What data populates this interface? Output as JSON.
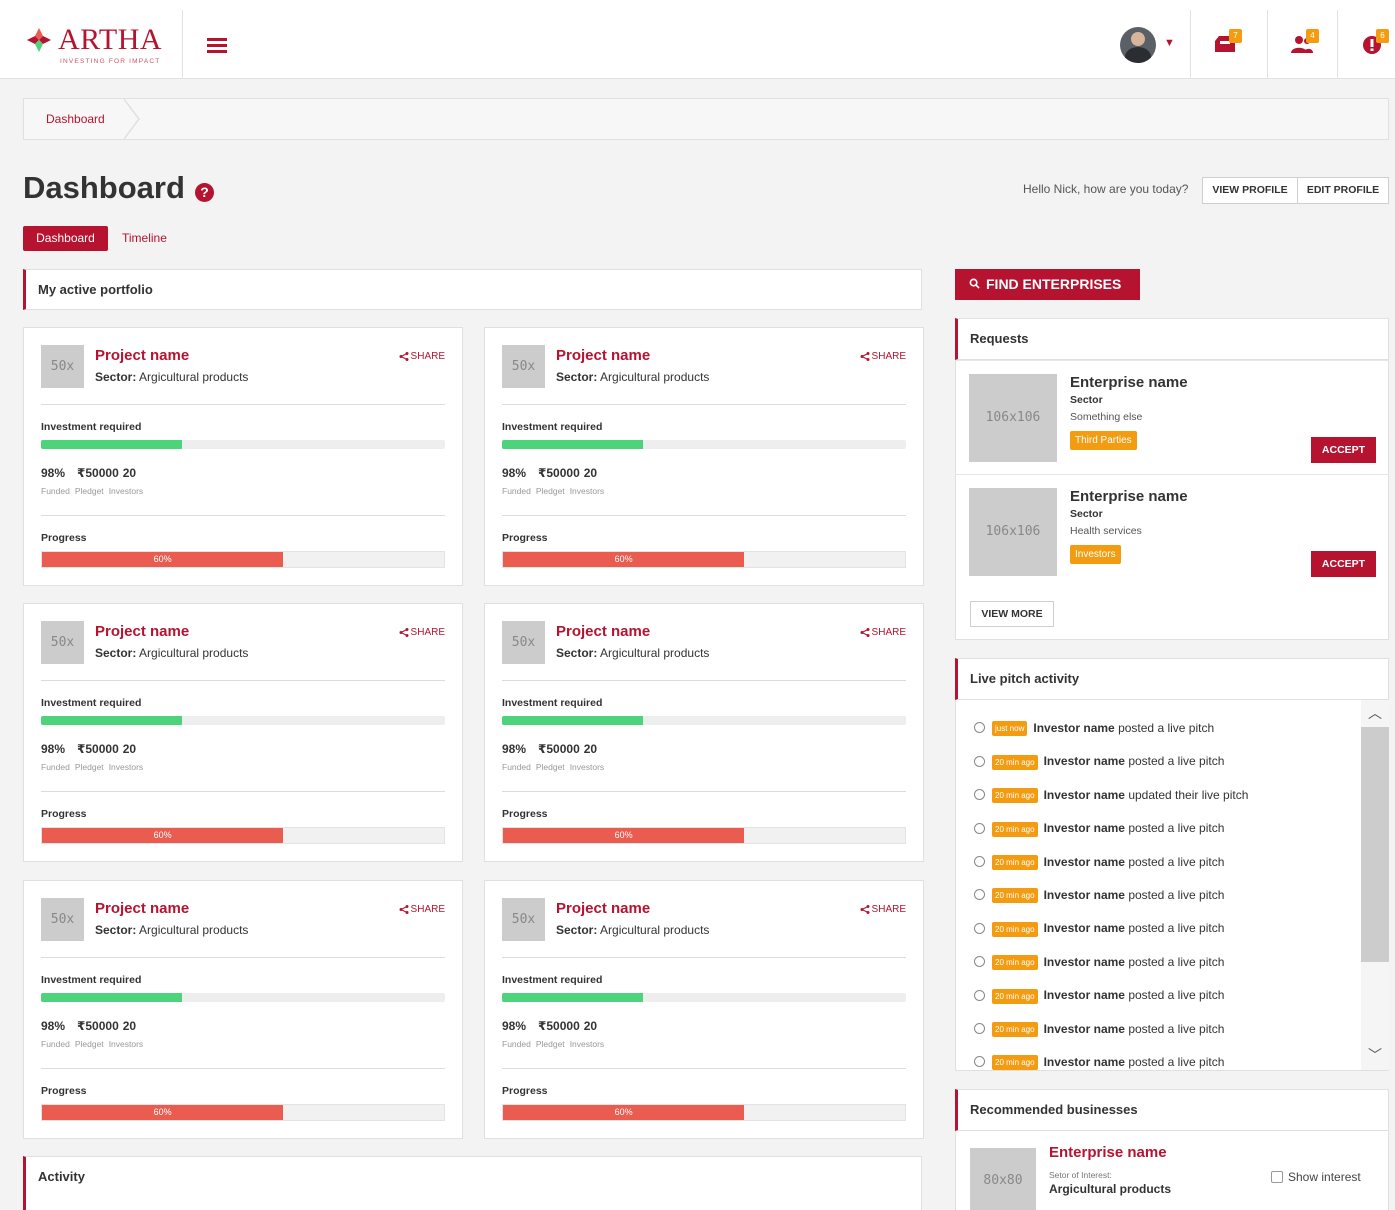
{
  "header": {
    "logo_text": "ARTHA",
    "logo_tagline": "INVESTING FOR IMPACT",
    "badges": {
      "messages": "7",
      "users": "4",
      "alerts": "6"
    }
  },
  "breadcrumb": [
    "Dashboard"
  ],
  "page": {
    "title": "Dashboard",
    "help": "?",
    "greeting": "Hello Nick, how are you today?",
    "view_profile": "VIEW PROFILE",
    "edit_profile": "EDIT PROFILE",
    "tabs": {
      "active": "Dashboard",
      "other": "Timeline"
    }
  },
  "portfolio": {
    "heading": "My active portfolio",
    "cards": [
      {
        "thumb": "50x",
        "name": "Project name",
        "sector_label": "Sector:",
        "sector": "Argicultural products",
        "share": "SHARE",
        "invest_label": "Investment required",
        "invest_fraction": 0.35,
        "funded": "98%",
        "pledged": "₹50000",
        "investors": "20",
        "funded_lbl": "Funded",
        "pledged_lbl": "Pledget",
        "investors_lbl": "Investors",
        "progress_label": "Progress",
        "progress": "60%"
      },
      {
        "thumb": "50x",
        "name": "Project name",
        "sector_label": "Sector:",
        "sector": "Argicultural products",
        "share": "SHARE",
        "invest_label": "Investment required",
        "invest_fraction": 0.35,
        "funded": "98%",
        "pledged": "₹50000",
        "investors": "20",
        "funded_lbl": "Funded",
        "pledged_lbl": "Pledget",
        "investors_lbl": "Investors",
        "progress_label": "Progress",
        "progress": "60%"
      },
      {
        "thumb": "50x",
        "name": "Project name",
        "sector_label": "Sector:",
        "sector": "Argicultural products",
        "share": "SHARE",
        "invest_label": "Investment required",
        "invest_fraction": 0.35,
        "funded": "98%",
        "pledged": "₹50000",
        "investors": "20",
        "funded_lbl": "Funded",
        "pledged_lbl": "Pledget",
        "investors_lbl": "Investors",
        "progress_label": "Progress",
        "progress": "60%"
      },
      {
        "thumb": "50x",
        "name": "Project name",
        "sector_label": "Sector:",
        "sector": "Argicultural products",
        "share": "SHARE",
        "invest_label": "Investment required",
        "invest_fraction": 0.35,
        "funded": "98%",
        "pledged": "₹50000",
        "investors": "20",
        "funded_lbl": "Funded",
        "pledged_lbl": "Pledget",
        "investors_lbl": "Investors",
        "progress_label": "Progress",
        "progress": "60%"
      },
      {
        "thumb": "50x",
        "name": "Project name",
        "sector_label": "Sector:",
        "sector": "Argicultural products",
        "share": "SHARE",
        "invest_label": "Investment required",
        "invest_fraction": 0.35,
        "funded": "98%",
        "pledged": "₹50000",
        "investors": "20",
        "funded_lbl": "Funded",
        "pledged_lbl": "Pledget",
        "investors_lbl": "Investors",
        "progress_label": "Progress",
        "progress": "60%"
      },
      {
        "thumb": "50x",
        "name": "Project name",
        "sector_label": "Sector:",
        "sector": "Argicultural products",
        "share": "SHARE",
        "invest_label": "Investment required",
        "invest_fraction": 0.35,
        "funded": "98%",
        "pledged": "₹50000",
        "investors": "20",
        "funded_lbl": "Funded",
        "pledged_lbl": "Pledget",
        "investors_lbl": "Investors",
        "progress_label": "Progress",
        "progress": "60%"
      }
    ]
  },
  "activity": {
    "heading": "Activity"
  },
  "find": {
    "label": "FIND ENTERPRISES"
  },
  "requests": {
    "heading": "Requests",
    "items": [
      {
        "thumb": "106x106",
        "name": "Enterprise name",
        "sector_label": "Sector",
        "sector": "Something else",
        "tag": "Third Parties",
        "accept": "ACCEPT"
      },
      {
        "thumb": "106x106",
        "name": "Enterprise name",
        "sector_label": "Sector",
        "sector": "Health services",
        "tag": "Investors",
        "accept": "ACCEPT"
      }
    ],
    "view_more": "VIEW MORE"
  },
  "live": {
    "heading": "Live pitch activity",
    "items": [
      {
        "time": "just now",
        "who": "Investor name",
        "what": "posted a live pitch"
      },
      {
        "time": "20 min ago",
        "who": "Investor name",
        "what": "posted a live pitch"
      },
      {
        "time": "20 min ago",
        "who": "Investor name",
        "what": "updated their live pitch"
      },
      {
        "time": "20 min ago",
        "who": "Investor name",
        "what": "posted a live pitch"
      },
      {
        "time": "20 min ago",
        "who": "Investor name",
        "what": "posted a live pitch"
      },
      {
        "time": "20 min ago",
        "who": "Investor name",
        "what": "posted a live pitch"
      },
      {
        "time": "20 min ago",
        "who": "Investor name",
        "what": "posted a live pitch"
      },
      {
        "time": "20 min ago",
        "who": "Investor name",
        "what": "posted a live pitch"
      },
      {
        "time": "20 min ago",
        "who": "Investor name",
        "what": "posted a live pitch"
      },
      {
        "time": "20 min ago",
        "who": "Investor name",
        "what": "posted a live pitch"
      },
      {
        "time": "20 min ago",
        "who": "Investor name",
        "what": "posted a live pitch"
      }
    ]
  },
  "recommended": {
    "heading": "Recommended businesses",
    "items": [
      {
        "thumb": "80x80",
        "name": "Enterprise name",
        "sector_label": "Setor of Interest:",
        "sector": "Argicultural products",
        "interest": "Show interest"
      }
    ]
  },
  "colors": {
    "brand": "#b5132f",
    "orange": "#f39c12",
    "green": "#4cd37b",
    "progress": "#e95c4f"
  }
}
